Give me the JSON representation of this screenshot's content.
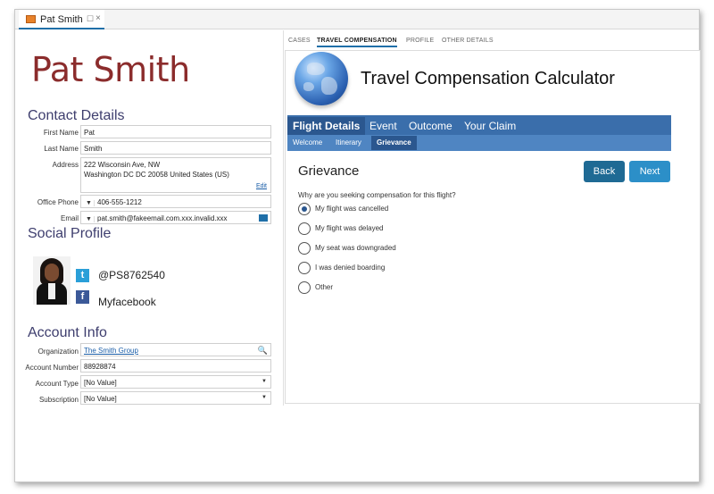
{
  "tab": {
    "title": "Pat Smith",
    "pin": "☐",
    "close": "×"
  },
  "contact": {
    "name": "Pat Smith",
    "section_title": "Contact Details",
    "first_name_label": "First Name",
    "first_name": "Pat",
    "last_name_label": "Last Name",
    "last_name": "Smith",
    "address_label": "Address",
    "address_line1": "222 Wisconsin Ave, NW",
    "address_line2": "Washington DC DC 20058 United States (US)",
    "edit_label": "Edit",
    "office_phone_label": "Office Phone",
    "office_phone": "406-555-1212",
    "email_label": "Email",
    "email": "pat.smith@fakeemail.com.xxx.invalid.xxx"
  },
  "social": {
    "section_title": "Social Profile",
    "twitter_handle": "@PS8762540",
    "facebook_name": "Myfacebook"
  },
  "account": {
    "section_title": "Account Info",
    "organization_label": "Organization",
    "organization": "The Smith Group",
    "account_number_label": "Account Number",
    "account_number": "88928874",
    "account_type_label": "Account Type",
    "account_type": "[No Value]",
    "subscription_label": "Subscription",
    "subscription": "[No Value]"
  },
  "subtabs": [
    "CASES",
    "TRAVEL COMPENSATION",
    "PROFILE",
    "OTHER DETAILS"
  ],
  "calculator": {
    "title": "Travel Compensation Calculator",
    "nav_main": [
      "Flight Details",
      "Event",
      "Outcome",
      "Your Claim"
    ],
    "nav_sub": [
      "Welcome",
      "Itinerary",
      "Grievance"
    ],
    "heading": "Grievance",
    "back_label": "Back",
    "next_label": "Next",
    "question": "Why are you seeking compensation for this flight?",
    "options": [
      "My flight was cancelled",
      "My flight was delayed",
      "My seat was downgraded",
      "I was denied boarding",
      "Other"
    ],
    "selected_option": "My flight was cancelled"
  },
  "colors": {
    "name_color": "#8b2c2c",
    "nav_blue": "#3a6eab",
    "button_back": "#1f6a94",
    "button_next": "#2c8fc8"
  }
}
